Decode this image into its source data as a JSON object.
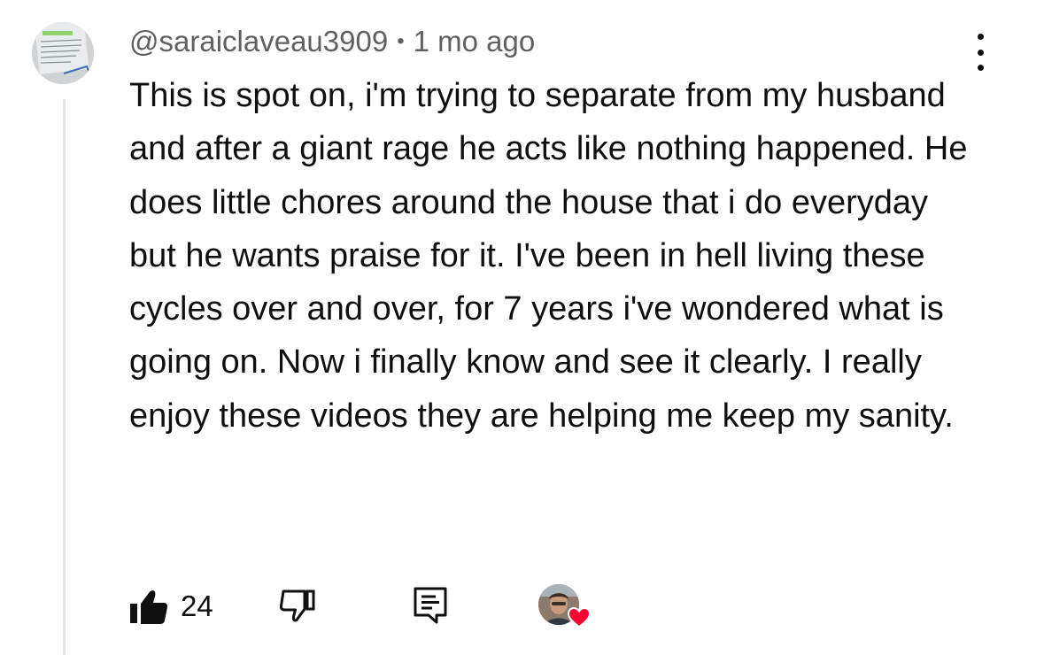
{
  "comment": {
    "author": "@saraiclaveau3909",
    "separator": "•",
    "timestamp": "1 mo ago",
    "text": "This is spot on, i'm trying to separate from my husband and after a giant rage he acts like nothing happened. He does little chores around the house that i do everyday but he wants praise for it. I've been in hell living these cycles over and over, for 7 years i've wondered what is going on. Now i finally know and see it clearly. I really enjoy these videos they are helping me keep my sanity."
  },
  "actions": {
    "like_count": "24",
    "like_icon": "thumbs-up-filled-icon",
    "dislike_icon": "thumbs-down-outline-icon",
    "reply_icon": "reply-comment-icon",
    "creator_heart_icon": "creator-heart-icon"
  },
  "menu_icon": "more-vertical-icon",
  "colors": {
    "text_primary": "#0f0f0f",
    "text_secondary": "#606060",
    "heart": "#ff0033",
    "thread_line": "#e5e5e5"
  }
}
